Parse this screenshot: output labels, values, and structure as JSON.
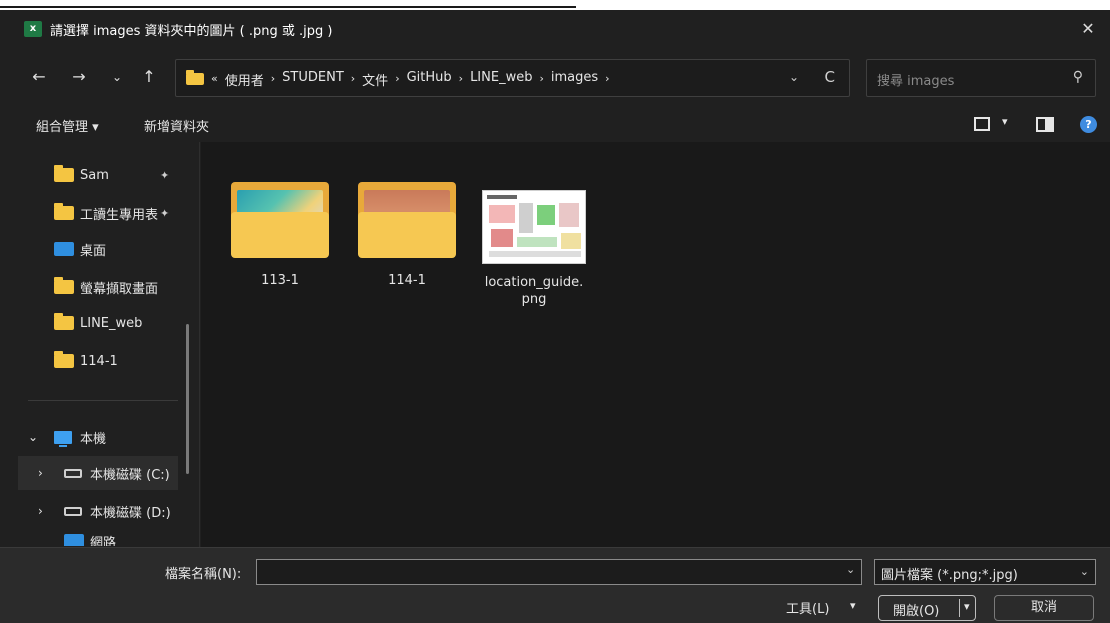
{
  "window": {
    "title": "請選擇 images 資料夾中的圖片 ( .png 或 .jpg )",
    "app_icon": "excel-icon",
    "close_label": "✕"
  },
  "nav": {
    "back": "←",
    "forward": "→",
    "recent": "⌄",
    "up": "↑"
  },
  "address": {
    "overflow": "«",
    "crumbs": [
      "使用者",
      "STUDENT",
      "文件",
      "GitHub",
      "LINE_web",
      "images"
    ],
    "separator": "›",
    "dropdown": "⌄",
    "refresh": "C"
  },
  "search": {
    "placeholder": "搜尋 images",
    "icon": "⚲"
  },
  "toolbar": {
    "organize": "組合管理 ▾",
    "new_folder": "新增資料夾",
    "view_dd": "▾",
    "help": "?"
  },
  "sidebar": {
    "items": [
      {
        "label": "Sam",
        "icon": "folder-icon",
        "pinned": true
      },
      {
        "label": "工讀生專用表",
        "icon": "folder-icon",
        "pinned": true
      },
      {
        "label": "桌面",
        "icon": "desktop-icon",
        "pinned": false
      },
      {
        "label": "螢幕擷取畫面",
        "icon": "folder-icon",
        "pinned": false
      },
      {
        "label": "LINE_web",
        "icon": "folder-icon",
        "pinned": false
      },
      {
        "label": "114-1",
        "icon": "folder-icon",
        "pinned": false
      }
    ],
    "pin_glyph": "📌",
    "this_pc": "本機",
    "drives": [
      "本機磁碟 (C:)",
      "本機磁碟 (D:)"
    ],
    "network": "網路"
  },
  "files": [
    {
      "name": "113-1",
      "type": "folder"
    },
    {
      "name": "114-1",
      "type": "folder"
    },
    {
      "name": "location_guide.\npng",
      "type": "image"
    }
  ],
  "footer": {
    "filename_label": "檔案名稱(N):",
    "filename_value": "",
    "filetype": "圖片檔案 (*.png;*.jpg)",
    "tools": "工具(L)",
    "open": "開啟(O)",
    "cancel": "取消",
    "dd": "⌄"
  }
}
